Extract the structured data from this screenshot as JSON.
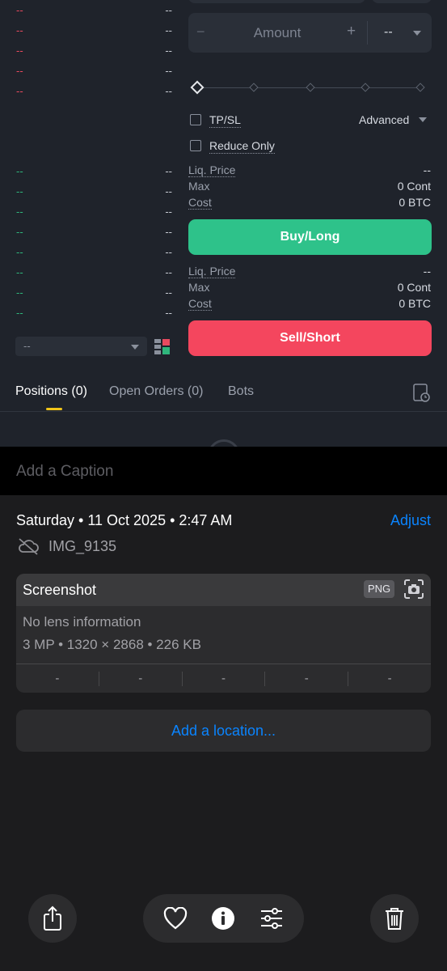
{
  "orderbook": {
    "asks": [
      {
        "price": "--",
        "qty": "--"
      },
      {
        "price": "--",
        "qty": "--"
      },
      {
        "price": "--",
        "qty": "--"
      },
      {
        "price": "--",
        "qty": "--"
      },
      {
        "price": "--",
        "qty": "--"
      }
    ],
    "bids": [
      {
        "price": "--",
        "qty": "--"
      },
      {
        "price": "--",
        "qty": "--"
      },
      {
        "price": "--",
        "qty": "--"
      },
      {
        "price": "--",
        "qty": "--"
      },
      {
        "price": "--",
        "qty": "--"
      },
      {
        "price": "--",
        "qty": "--"
      },
      {
        "price": "--",
        "qty": "--"
      },
      {
        "price": "--",
        "qty": "--"
      }
    ],
    "depth_select": "--"
  },
  "order_form": {
    "amount_placeholder": "Amount",
    "minus": "−",
    "plus": "+",
    "unit_select": "--",
    "tpsl_label": "TP/SL",
    "advanced_label": "Advanced",
    "reduce_only_label": "Reduce Only",
    "long_info": {
      "liq_label": "Liq. Price",
      "liq_value": "--",
      "max_label": "Max",
      "max_value": "0 Cont",
      "cost_label": "Cost",
      "cost_value": "0 BTC"
    },
    "buy_label": "Buy/Long",
    "short_info": {
      "liq_label": "Liq. Price",
      "liq_value": "--",
      "max_label": "Max",
      "max_value": "0 Cont",
      "cost_label": "Cost",
      "cost_value": "0 BTC"
    },
    "sell_label": "Sell/Short"
  },
  "tabs": {
    "positions": "Positions (0)",
    "open_orders": "Open Orders (0)",
    "bots": "Bots"
  },
  "caption_placeholder": "Add a Caption",
  "photo_info": {
    "date_line": "Saturday • 11 Oct 2025 • 2:47 AM",
    "adjust_label": "Adjust",
    "filename": "IMG_9135",
    "card_title": "Screenshot",
    "format_badge": "PNG",
    "lens_info": "No lens information",
    "specs": "3 MP • 1320 × 2868 • 226 KB",
    "exif": [
      "-",
      "-",
      "-",
      "-",
      "-"
    ],
    "location_label": "Add a location..."
  },
  "colors": {
    "ask_red": "#e84a5f",
    "bid_green": "#2fb67c",
    "buy_green": "#2ec28a",
    "sell_red": "#f4465e",
    "tab_indicator": "#f0c419",
    "ios_blue": "#0a84ff"
  },
  "icons": [
    "cloud-off-icon",
    "camera-icon",
    "share-icon",
    "heart-icon",
    "info-icon",
    "sliders-icon",
    "trash-icon",
    "history-icon",
    "layout-icon"
  ]
}
